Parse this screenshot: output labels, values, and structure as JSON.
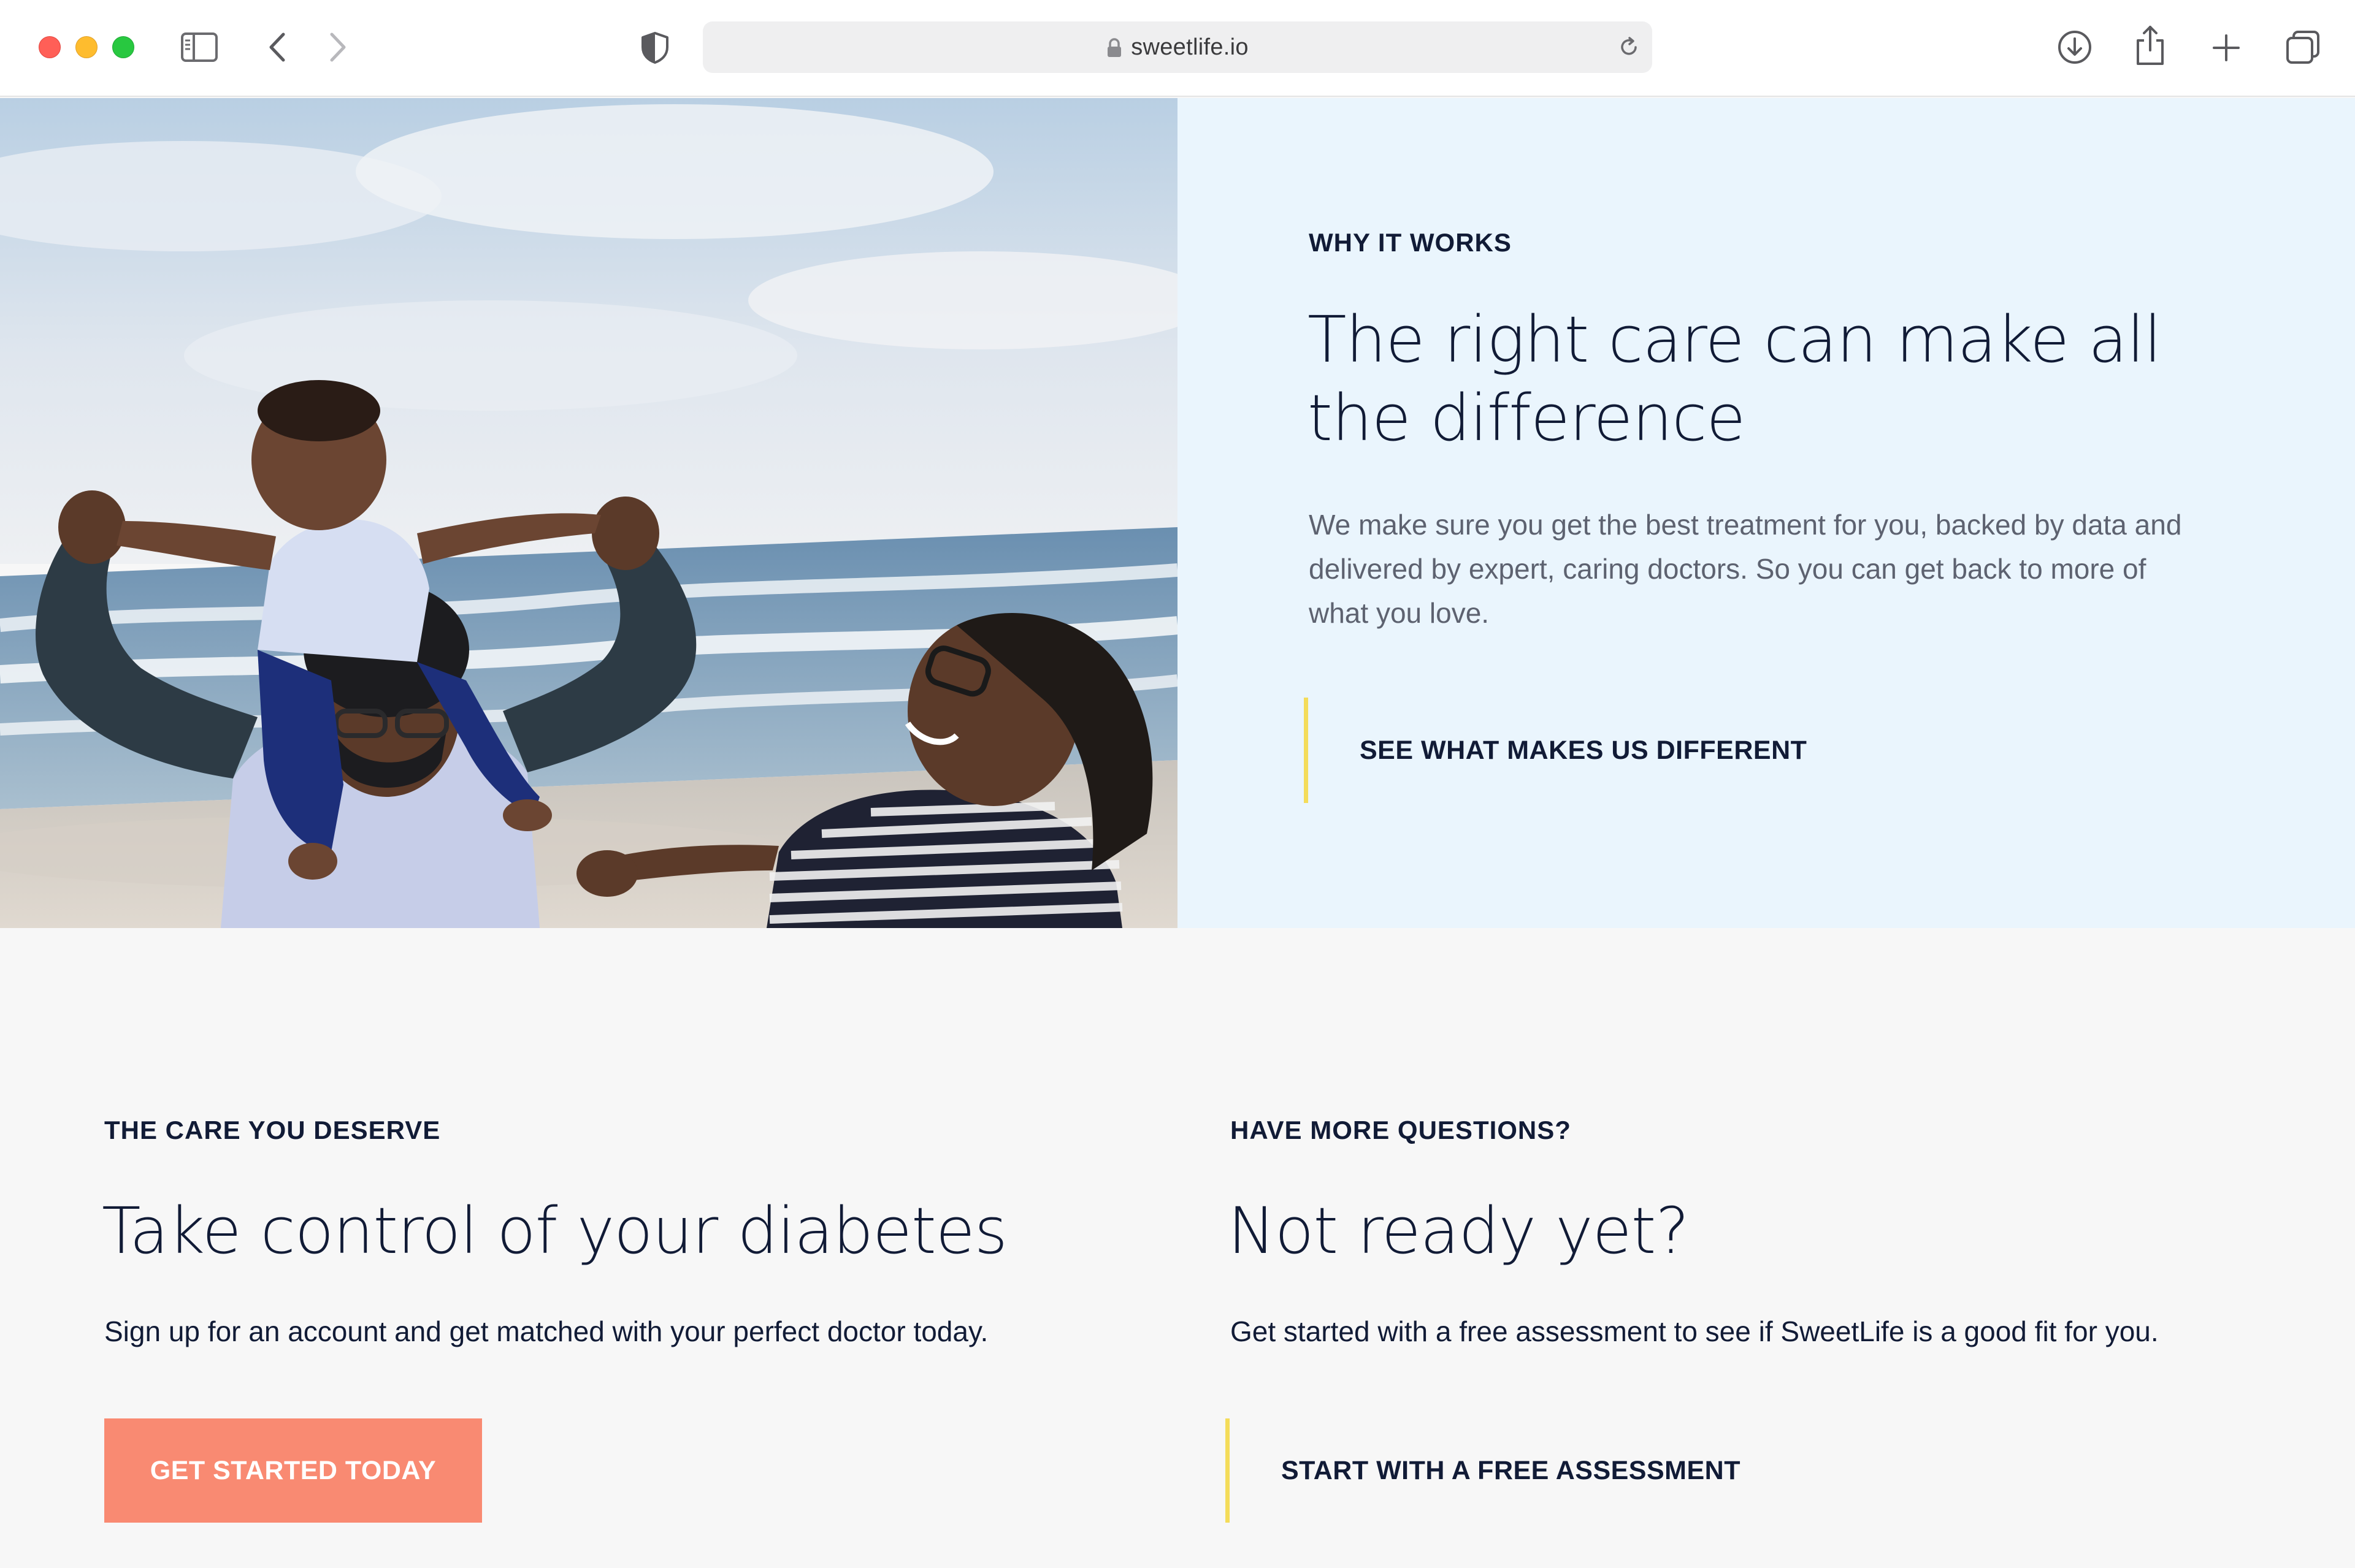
{
  "browser": {
    "url": "sweetlife.io",
    "icons": {
      "sidebar": "sidebar-icon",
      "back": "chevron-left-icon",
      "forward": "chevron-right-icon",
      "privacy": "shield-icon",
      "lock": "lock-icon",
      "reload": "reload-icon",
      "download": "download-icon",
      "share": "share-icon",
      "new_tab": "plus-icon",
      "tab_overview": "tabs-icon"
    }
  },
  "hero": {
    "eyebrow": "WHY IT WORKS",
    "title": "The right care can make all the difference",
    "body": "We make sure you get the best treatment for you, backed by data and delivered by expert, caring doctors. So you can get back to more of what you love.",
    "link_label": "SEE WHAT MAKES US DIFFERENT"
  },
  "care_section": {
    "eyebrow": "THE CARE YOU DESERVE",
    "title": "Take control of your diabetes",
    "body": "Sign up for an account and get matched with your perfect doctor today.",
    "button_label": "GET STARTED TODAY"
  },
  "questions_section": {
    "eyebrow": "HAVE MORE QUESTIONS?",
    "title": "Not ready yet?",
    "body": "Get started with a free assessment to see if SweetLife is a good fit for you.",
    "link_label": "START WITH A FREE ASSESSMENT"
  },
  "colors": {
    "navy_text": "#111b36",
    "hero_panel_bg": "#eaf5fd",
    "page_bg": "#f7f7f7",
    "cta_coral": "#f98a72",
    "accent_yellow": "#f4dc5a"
  }
}
